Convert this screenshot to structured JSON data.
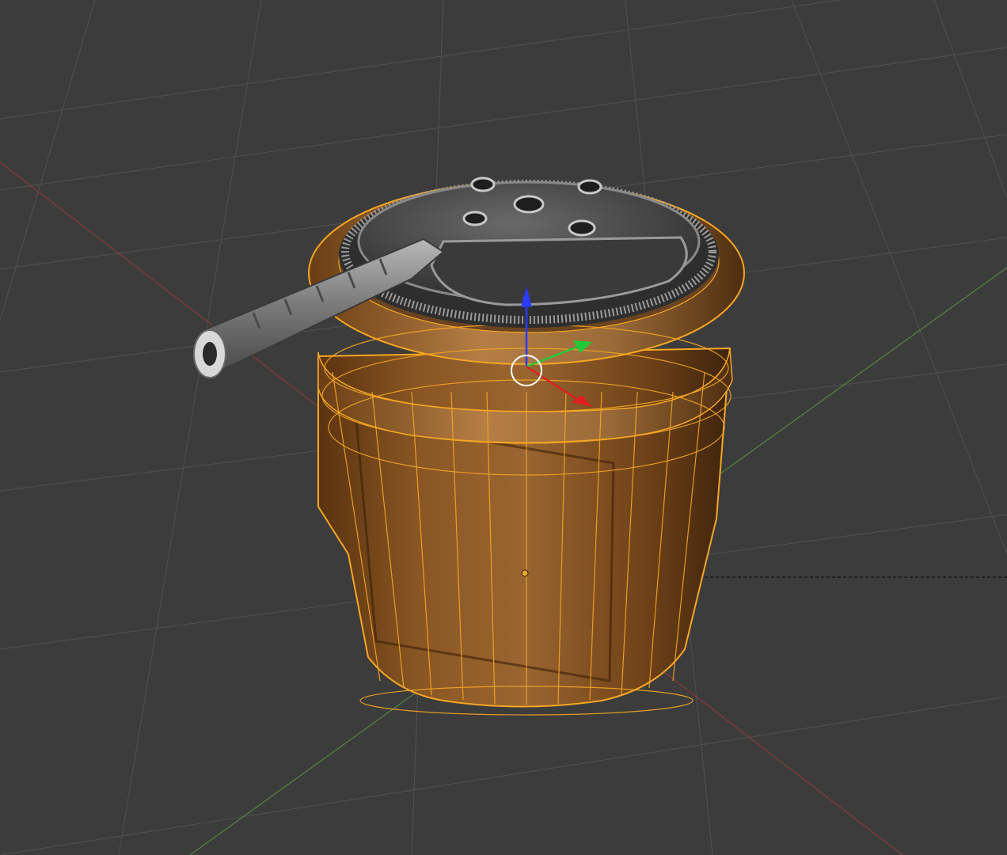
{
  "viewport": {
    "mode": "3d-viewport",
    "background": "#3c3c3c",
    "grid_color": "#4e4e4e",
    "x_axis_color": "#8a3a3a",
    "y_axis_color": "#4c8a3a",
    "selection_color": "#f5a623",
    "gizmo": {
      "z_color": "#2a3cff",
      "y_color": "#22c83a",
      "x_color": "#e02020"
    }
  },
  "object": {
    "type": "barrel",
    "selected": true,
    "body_color": "#7a4a1c",
    "lid_color": "#4a4a4a",
    "pipe_color": "#8a8a8a"
  }
}
